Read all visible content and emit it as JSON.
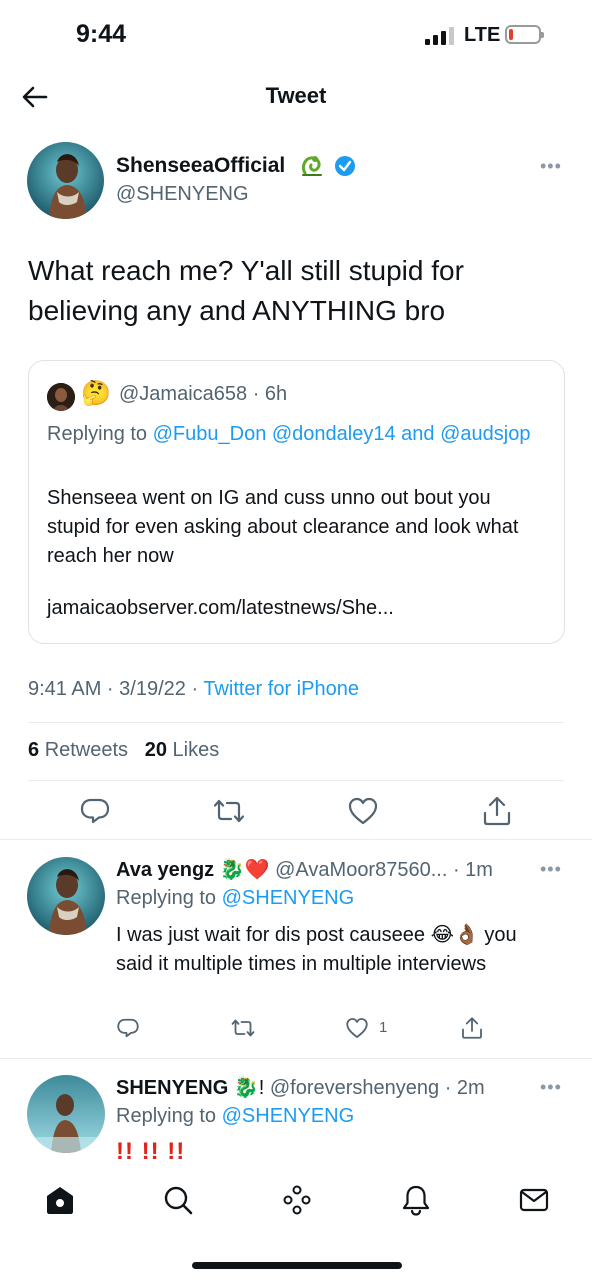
{
  "status_bar": {
    "time": "9:44",
    "network": "LTE",
    "battery_level": 0.15,
    "battery_color": "#e43d30"
  },
  "header": {
    "title": "Tweet"
  },
  "tweet": {
    "author_name": "ShenseeaOfficial",
    "author_handle": "@SHENYENG",
    "text": "What reach me? Y'all still stupid for believing any and ANYTHING bro",
    "quoted": {
      "handle_time": "@Jamaica658 · 6h",
      "emoji": "🤔",
      "replying_prefix": "Replying to",
      "replying_to": "@Fubu_Don @dondaley14 and @audsjop",
      "body": "Shenseea went on IG and cuss unno out bout you stupid for even asking about clearance and look what reach her now",
      "url": "jamaicaobserver.com/latestnews/She..."
    },
    "time": "9:41 AM · 3/19/22 ·",
    "source": "Twitter for iPhone",
    "retweets_count": "6",
    "retweets_label": "Retweets",
    "likes_count": "20",
    "likes_label": "Likes"
  },
  "replies": [
    {
      "name": "Ava yengz",
      "name_suffix": "🐉❤️",
      "handle_time": "@AvaMoor87560... · 1m",
      "replying_prefix": "Replying to",
      "replying_to": "@SHENYENG",
      "body": "I was just wait for dis post causeee 😂👌🏾 you said it multiple times in multiple interviews",
      "like_count": "1"
    },
    {
      "name": "SHENYENG",
      "name_suffix": "🐉!",
      "handle_time": "@forevershenyeng · 2m",
      "replying_prefix": "Replying to",
      "replying_to": "@SHENYENG",
      "body": "!! !! !!"
    }
  ],
  "colors": {
    "accent": "#1d9bf0",
    "verified": "#1d9bf0",
    "secondary_text": "#536471",
    "dragon_green": "#5fa82b"
  },
  "icons": {
    "back": "back-arrow-icon",
    "more": "more-dots-icon",
    "reply": "reply-icon",
    "retweet": "retweet-icon",
    "like": "heart-icon",
    "share": "share-icon",
    "nav": [
      "home-icon",
      "search-icon",
      "spaces-icon",
      "notifications-icon",
      "messages-icon"
    ]
  }
}
